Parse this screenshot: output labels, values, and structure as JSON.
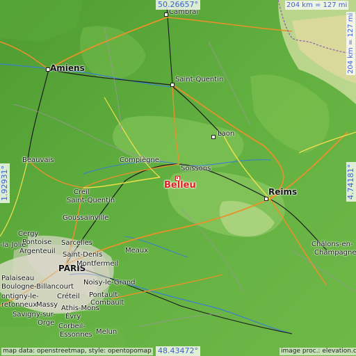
{
  "coords": {
    "top": "50.26657°",
    "bottom": "48.43472°",
    "left": "1.92931°",
    "right": "4.74181°"
  },
  "scale": {
    "horizontal": "204 km = 127 mi",
    "vertical": "204 km = 127 mi"
  },
  "credits": {
    "left": "map data: openstreetmap, style: opentopomap",
    "right": "image proc.: elevation.city"
  },
  "featured_place": "Belleu",
  "places": {
    "cambrai": "Cambrai",
    "amiens": "Amiens",
    "saint_quentin": "Saint-Quentin",
    "laon": "Laon",
    "compiegne": "Compiègne",
    "soissons": "Soissons",
    "beauvais": "Beauvais",
    "reims": "Reims",
    "creil": "Creil",
    "saint_quentin_2": "Saint-Quentin",
    "goussainville": "Goussainville",
    "cergy": "Cergy",
    "pontoise": "Pontoise",
    "sarcelles": "Sarcelles",
    "la_jolie": "-la-Jolie",
    "argenteuil": "Argenteuil",
    "saint_denis": "Saint-Denis",
    "paris": "PARIS",
    "montfermeil": "Montfermeil",
    "meaux": "Meaux",
    "chalons": "Châlons-en-",
    "champagne": "Champagne",
    "palaiseau": "Palaiseau",
    "boulogne": "Boulogne-Billancourt",
    "noisy": "Noisy-le-Grand",
    "montigny": "ontigny-le-",
    "bretonneux": "retonneux",
    "creteil": "Créteil",
    "pontault": "Pontault-",
    "combault": "Combault",
    "massy": "Massy",
    "athis_mons": "Athis-Mons",
    "savigny": "Savigny-sur-",
    "orge": "Orge",
    "evry": "Évry",
    "corbeil": "Corbeil-",
    "essonnes": "Essonnes",
    "melun": "Melun"
  }
}
